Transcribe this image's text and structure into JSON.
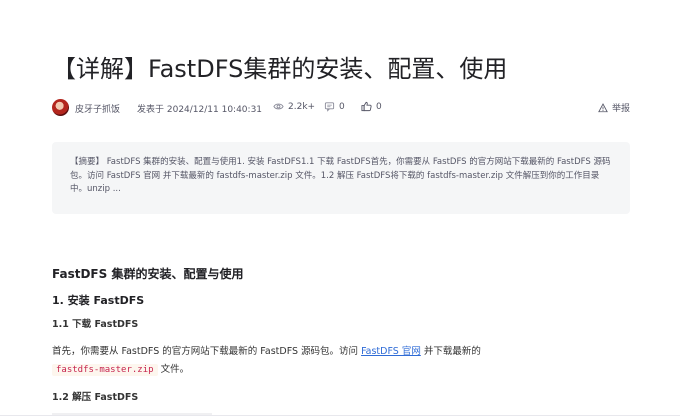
{
  "article": {
    "title": "【详解】FastDFS集群的安装、配置、使用",
    "meta": {
      "author": "皮牙子抓饭",
      "posted": "发表于 2024/12/11 10:40:31",
      "views": "2.2k+",
      "comments": "0",
      "likes": "0",
      "report_label": "举报"
    },
    "summary": "【摘要】 FastDFS 集群的安装、配置与使用1. 安装 FastDFS1.1 下载 FastDFS首先，你需要从 FastDFS 的官方网站下载最新的 FastDFS 源码包。访问 FastDFS 官网 并下载最新的 fastdfs-master.zip 文件。1.2 解压 FastDFS将下载的 fastdfs-master.zip 文件解压到你的工作目录中。unzip ...",
    "body": {
      "h2": "FastDFS 集群的安装、配置与使用",
      "h3": "1. 安装 FastDFS",
      "h4_download": "1.1 下载 FastDFS",
      "para_before_link": "首先，你需要从 FastDFS 的官方网站下载最新的 FastDFS 源码包。访问 ",
      "link_text": "FastDFS 官网",
      "para_after_link": " 并下载最新的",
      "code_file": "fastdfs-master.zip",
      "para_tail": " 文件。",
      "h4_unzip": "1.2 解压 FastDFS"
    }
  },
  "icons": {
    "views": "eye-icon",
    "comments": "comment-icon",
    "likes": "thumbs-up-icon",
    "report": "warning-icon"
  },
  "colors": {
    "link": "#2e6bd6",
    "code_text": "#c7254e",
    "summary_bg": "#f5f6f7"
  }
}
